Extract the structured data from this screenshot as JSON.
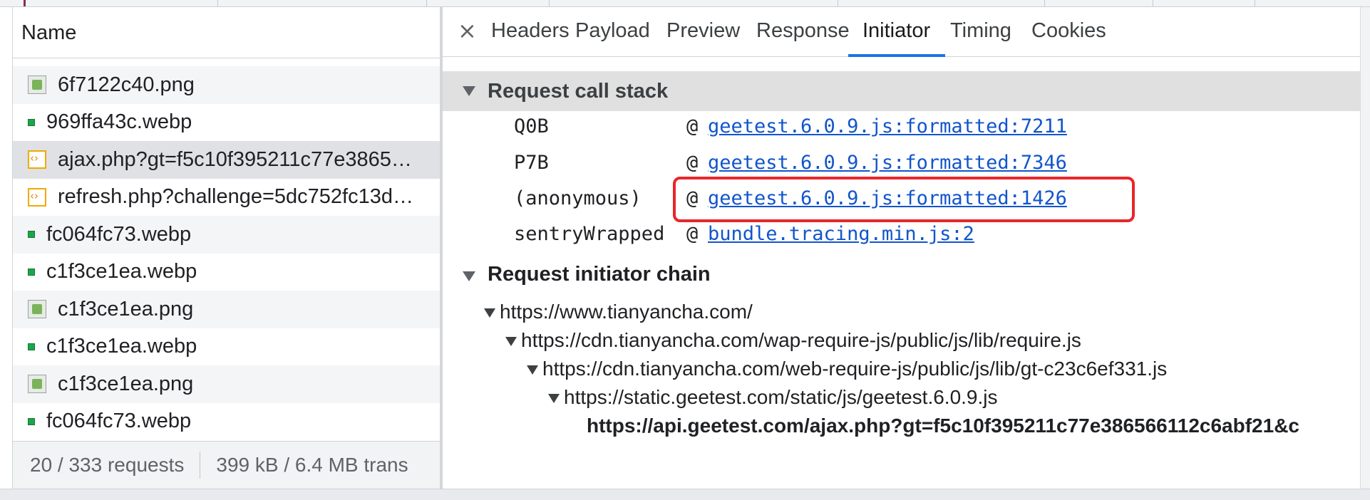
{
  "request_list": {
    "header": "Name",
    "rows": [
      {
        "name": "6f7122c40.png",
        "icon": "image-file-icon",
        "state": "alt"
      },
      {
        "name": "969ffa43c.webp",
        "icon": "webp-file-icon",
        "state": ""
      },
      {
        "name": "ajax.php?gt=f5c10f395211c77e3865…",
        "icon": "xhr-file-icon",
        "state": "selected"
      },
      {
        "name": "refresh.php?challenge=5dc752fc13d…",
        "icon": "xhr-file-icon",
        "state": ""
      },
      {
        "name": "fc064fc73.webp",
        "icon": "webp-file-icon",
        "state": "alt"
      },
      {
        "name": "c1f3ce1ea.webp",
        "icon": "webp-file-icon",
        "state": ""
      },
      {
        "name": "c1f3ce1ea.png",
        "icon": "image-file-icon",
        "state": "alt"
      },
      {
        "name": "c1f3ce1ea.webp",
        "icon": "webp-file-icon",
        "state": ""
      },
      {
        "name": "c1f3ce1ea.png",
        "icon": "image-file-icon",
        "state": "alt"
      },
      {
        "name": "fc064fc73.webp",
        "icon": "webp-file-icon",
        "state": ""
      }
    ],
    "status": {
      "requests": "20 / 333 requests",
      "transferred": "399 kB / 6.4 MB trans"
    }
  },
  "details": {
    "close_glyph": "×",
    "tabs": [
      "Headers",
      "Payload",
      "Preview",
      "Response",
      "Initiator",
      "Timing",
      "Cookies"
    ],
    "active_tab": "Initiator",
    "call_stack": {
      "title": "Request call stack",
      "frames": [
        {
          "fn": "Q0B",
          "at": "@",
          "link": "geetest.6.0.9.js:formatted:7211"
        },
        {
          "fn": "P7B",
          "at": "@",
          "link": "geetest.6.0.9.js:formatted:7346"
        },
        {
          "fn": "(anonymous)",
          "at": "@",
          "link": "geetest.6.0.9.js:formatted:1426"
        },
        {
          "fn": "sentryWrapped",
          "at": "@",
          "link": "bundle.tracing.min.js:2"
        }
      ]
    },
    "initiator_chain": {
      "title": "Request initiator chain",
      "items": [
        {
          "url": "https://www.tianyancha.com/"
        },
        {
          "url": "https://cdn.tianyancha.com/wap-require-js/public/js/lib/require.js"
        },
        {
          "url": "https://cdn.tianyancha.com/web-require-js/public/js/lib/gt-c23c6ef331.js"
        },
        {
          "url": "https://static.geetest.com/static/js/geetest.6.0.9.js"
        },
        {
          "url": "https://api.geetest.com/ajax.php?gt=f5c10f395211c77e386566112c6abf21&c"
        }
      ]
    }
  },
  "colors": {
    "link": "#1155cc",
    "active_tab_underline": "#1a73e8",
    "highlight_box": "#e8262a",
    "selected_row": "#dfe1e5"
  }
}
